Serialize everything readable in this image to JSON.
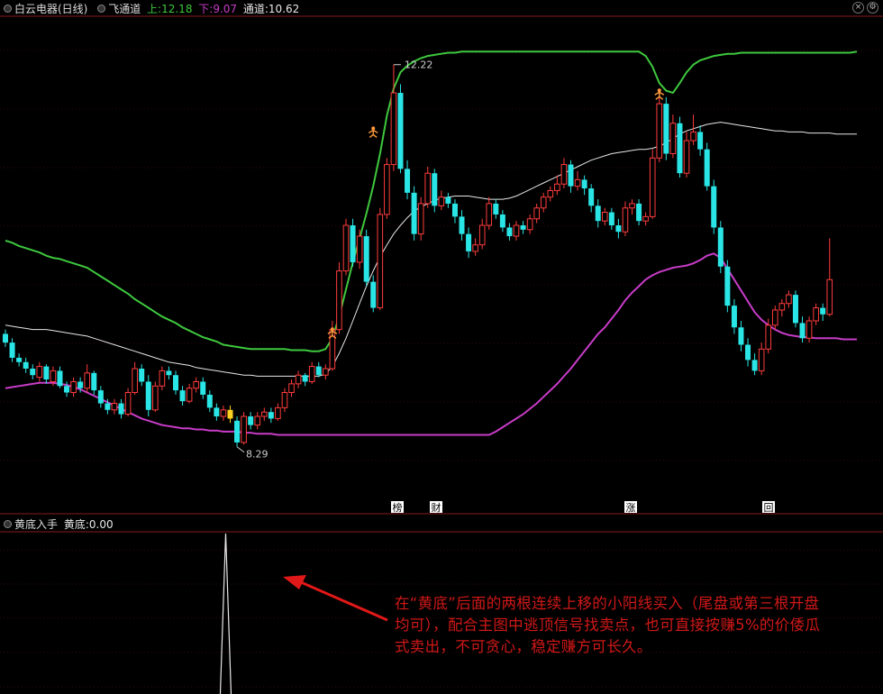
{
  "header": {
    "stock": "白云电器(日线)",
    "indicator": "飞通道",
    "upper_label": "上:",
    "upper_value": "12.18",
    "lower_label": "下:",
    "lower_value": "9.07",
    "mid_label": "通道:",
    "mid_value": "10.62"
  },
  "sub_header": {
    "indicator": "黄底入手",
    "value_label": "黄底:",
    "value": "0.00"
  },
  "markers": [
    "榜",
    "财",
    "涨",
    "回"
  ],
  "annotation": "在“黄底”后面的两根连续上移的小阳线买入（尾盘或第三根开盘均可），配合主图中逃顶信号找卖点，也可直接按赚5%的价倭瓜式卖出，不可贪心，稳定赚方可长久。",
  "colors": {
    "up": "#ff3c3c",
    "down": "#2ae5e5",
    "upper_band": "#3ec83e",
    "lower_band": "#c83cc8",
    "mid_line": "#e8e8e8",
    "signal_bar": "#ffd020",
    "arrow": "#e01818"
  },
  "chart_data": {
    "type": "candlestick",
    "price_high_label": "12.22",
    "price_low_label": "8.29",
    "ylim": [
      8.1,
      12.5
    ],
    "candles": [
      [
        9.74,
        9.66,
        9.78,
        9.62
      ],
      [
        9.66,
        9.52,
        9.7,
        9.48
      ],
      [
        9.52,
        9.48,
        9.56,
        9.44
      ],
      [
        9.48,
        9.42,
        9.52,
        9.38
      ],
      [
        9.42,
        9.36,
        9.46,
        9.32
      ],
      [
        9.34,
        9.44,
        9.48,
        9.3
      ],
      [
        9.44,
        9.32,
        9.46,
        9.28
      ],
      [
        9.3,
        9.4,
        9.44,
        9.26
      ],
      [
        9.4,
        9.26,
        9.44,
        9.24
      ],
      [
        9.26,
        9.2,
        9.3,
        9.16
      ],
      [
        9.2,
        9.3,
        9.34,
        9.16
      ],
      [
        9.3,
        9.24,
        9.34,
        9.2
      ],
      [
        9.24,
        9.38,
        9.46,
        9.2
      ],
      [
        9.38,
        9.22,
        9.4,
        9.18
      ],
      [
        9.22,
        9.1,
        9.26,
        9.06
      ],
      [
        9.1,
        9.04,
        9.14,
        9.0
      ],
      [
        9.04,
        9.1,
        9.14,
        9.0
      ],
      [
        9.1,
        9.0,
        9.14,
        8.96
      ],
      [
        9.0,
        9.2,
        9.24,
        8.98
      ],
      [
        9.2,
        9.42,
        9.48,
        9.18
      ],
      [
        9.42,
        9.3,
        9.46,
        9.26
      ],
      [
        9.3,
        9.04,
        9.36,
        8.98
      ],
      [
        9.04,
        9.26,
        9.3,
        9.02
      ],
      [
        9.26,
        9.4,
        9.44,
        9.22
      ],
      [
        9.4,
        9.36,
        9.44,
        9.32
      ],
      [
        9.36,
        9.22,
        9.4,
        9.18
      ],
      [
        9.22,
        9.12,
        9.26,
        9.08
      ],
      [
        9.12,
        9.24,
        9.28,
        9.1
      ],
      [
        9.24,
        9.3,
        9.34,
        9.2
      ],
      [
        9.3,
        9.18,
        9.34,
        9.14
      ],
      [
        9.18,
        9.06,
        9.22,
        9.02
      ],
      [
        9.06,
        8.98,
        9.1,
        8.94
      ],
      [
        8.98,
        9.04,
        9.08,
        8.94
      ],
      [
        9.04,
        8.96,
        9.08,
        8.92
      ],
      [
        8.94,
        8.74,
        8.98,
        8.7
      ],
      [
        8.74,
        8.98,
        9.02,
        8.72
      ],
      [
        8.98,
        8.9,
        9.02,
        8.86
      ],
      [
        8.9,
        8.98,
        9.02,
        8.86
      ],
      [
        8.98,
        9.02,
        9.06,
        8.94
      ],
      [
        9.02,
        8.96,
        9.06,
        8.92
      ],
      [
        8.96,
        9.06,
        9.1,
        8.94
      ],
      [
        9.06,
        9.2,
        9.24,
        9.02
      ],
      [
        9.2,
        9.28,
        9.32,
        9.16
      ],
      [
        9.28,
        9.36,
        9.4,
        9.24
      ],
      [
        9.36,
        9.3,
        9.38,
        9.26
      ],
      [
        9.3,
        9.44,
        9.48,
        9.28
      ],
      [
        9.44,
        9.36,
        9.48,
        9.34
      ],
      [
        9.36,
        9.42,
        9.46,
        9.32
      ],
      [
        9.42,
        9.78,
        9.86,
        9.4
      ],
      [
        9.78,
        10.32,
        10.4,
        9.74
      ],
      [
        10.32,
        10.74,
        10.8,
        10.28
      ],
      [
        10.74,
        10.4,
        10.8,
        10.36
      ],
      [
        10.4,
        10.64,
        10.7,
        10.34
      ],
      [
        10.64,
        10.22,
        10.7,
        10.18
      ],
      [
        10.22,
        9.98,
        10.28,
        9.94
      ],
      [
        9.98,
        10.84,
        10.9,
        9.96
      ],
      [
        10.84,
        11.3,
        11.36,
        10.8
      ],
      [
        11.3,
        11.96,
        12.22,
        11.24
      ],
      [
        11.96,
        11.26,
        12.04,
        11.22
      ],
      [
        11.26,
        11.04,
        11.34,
        10.98
      ],
      [
        11.04,
        10.66,
        11.1,
        10.6
      ],
      [
        10.66,
        10.94,
        11.0,
        10.6
      ],
      [
        10.94,
        11.22,
        11.28,
        10.9
      ],
      [
        11.22,
        10.92,
        11.26,
        10.86
      ],
      [
        10.92,
        11.0,
        11.06,
        10.88
      ],
      [
        11.0,
        10.94,
        11.04,
        10.9
      ],
      [
        10.94,
        10.82,
        10.98,
        10.76
      ],
      [
        10.82,
        10.66,
        10.88,
        10.6
      ],
      [
        10.66,
        10.5,
        10.72,
        10.44
      ],
      [
        10.5,
        10.56,
        10.62,
        10.46
      ],
      [
        10.56,
        10.74,
        10.8,
        10.52
      ],
      [
        10.74,
        10.94,
        11.0,
        10.7
      ],
      [
        10.94,
        10.84,
        10.98,
        10.8
      ],
      [
        10.84,
        10.72,
        10.88,
        10.68
      ],
      [
        10.72,
        10.64,
        10.76,
        10.6
      ],
      [
        10.64,
        10.74,
        10.78,
        10.6
      ],
      [
        10.74,
        10.7,
        10.78,
        10.66
      ],
      [
        10.7,
        10.8,
        10.84,
        10.66
      ],
      [
        10.8,
        10.9,
        10.94,
        10.76
      ],
      [
        10.9,
        11.0,
        11.04,
        10.86
      ],
      [
        11.0,
        11.06,
        11.1,
        10.96
      ],
      [
        11.06,
        11.12,
        11.2,
        11.02
      ],
      [
        11.12,
        11.3,
        11.36,
        11.08
      ],
      [
        11.3,
        11.1,
        11.34,
        11.04
      ],
      [
        11.1,
        11.16,
        11.24,
        11.06
      ],
      [
        11.16,
        11.08,
        11.2,
        11.02
      ],
      [
        11.08,
        10.92,
        11.12,
        10.86
      ],
      [
        10.92,
        10.78,
        10.98,
        10.72
      ],
      [
        10.78,
        10.86,
        10.9,
        10.74
      ],
      [
        10.86,
        10.74,
        10.9,
        10.7
      ],
      [
        10.74,
        10.68,
        10.8,
        10.62
      ],
      [
        10.68,
        10.9,
        10.96,
        10.64
      ],
      [
        10.9,
        10.94,
        10.98,
        10.84
      ],
      [
        10.94,
        10.78,
        10.98,
        10.74
      ],
      [
        10.78,
        10.82,
        10.86,
        10.74
      ],
      [
        10.82,
        11.36,
        11.44,
        10.8
      ],
      [
        11.36,
        11.86,
        11.94,
        11.32
      ],
      [
        11.86,
        11.4,
        11.92,
        11.34
      ],
      [
        11.4,
        11.68,
        11.76,
        11.36
      ],
      [
        11.68,
        11.22,
        11.74,
        11.18
      ],
      [
        11.22,
        11.52,
        11.6,
        11.18
      ],
      [
        11.52,
        11.6,
        11.76,
        11.48
      ],
      [
        11.6,
        11.44,
        11.66,
        11.38
      ],
      [
        11.44,
        11.1,
        11.5,
        11.06
      ],
      [
        11.1,
        10.72,
        11.16,
        10.66
      ],
      [
        10.72,
        10.36,
        10.78,
        10.3
      ],
      [
        10.36,
        10.0,
        10.42,
        9.94
      ],
      [
        10.0,
        9.8,
        10.06,
        9.74
      ],
      [
        9.8,
        9.64,
        9.86,
        9.58
      ],
      [
        9.64,
        9.5,
        9.7,
        9.44
      ],
      [
        9.5,
        9.4,
        9.56,
        9.36
      ],
      [
        9.4,
        9.6,
        9.66,
        9.36
      ],
      [
        9.6,
        9.82,
        9.88,
        9.56
      ],
      [
        9.82,
        9.96,
        10.0,
        9.78
      ],
      [
        9.96,
        10.02,
        10.06,
        9.9
      ],
      [
        10.02,
        10.1,
        10.14,
        9.98
      ],
      [
        10.1,
        9.84,
        10.14,
        9.8
      ],
      [
        9.84,
        9.7,
        9.9,
        9.66
      ],
      [
        9.7,
        9.86,
        9.9,
        9.66
      ],
      [
        9.86,
        9.98,
        10.02,
        9.82
      ],
      [
        9.98,
        9.92,
        10.02,
        9.86
      ],
      [
        9.92,
        10.24,
        10.62,
        9.9
      ]
    ],
    "upper_band": [
      10.6,
      10.58,
      10.55,
      10.53,
      10.51,
      10.49,
      10.46,
      10.44,
      10.43,
      10.41,
      10.39,
      10.37,
      10.35,
      10.31,
      10.27,
      10.23,
      10.19,
      10.15,
      10.11,
      10.06,
      10.02,
      9.98,
      9.94,
      9.9,
      9.87,
      9.84,
      9.8,
      9.77,
      9.74,
      9.71,
      9.69,
      9.67,
      9.64,
      9.63,
      9.62,
      9.61,
      9.6,
      9.6,
      9.6,
      9.6,
      9.6,
      9.6,
      9.59,
      9.59,
      9.59,
      9.58,
      9.58,
      9.6,
      9.7,
      9.9,
      10.15,
      10.4,
      10.62,
      10.85,
      11.1,
      11.4,
      11.75,
      12.0,
      12.15,
      12.21,
      12.25,
      12.28,
      12.3,
      12.31,
      12.32,
      12.33,
      12.33,
      12.34,
      12.34,
      12.34,
      12.34,
      12.34,
      12.34,
      12.34,
      12.34,
      12.34,
      12.34,
      12.34,
      12.34,
      12.34,
      12.34,
      12.34,
      12.34,
      12.34,
      12.34,
      12.34,
      12.34,
      12.34,
      12.34,
      12.34,
      12.34,
      12.34,
      12.34,
      12.34,
      12.3,
      12.2,
      12.05,
      11.98,
      11.96,
      12.05,
      12.15,
      12.22,
      12.26,
      12.28,
      12.3,
      12.31,
      12.32,
      12.32,
      12.33,
      12.33,
      12.33,
      12.33,
      12.33,
      12.33,
      12.33,
      12.33,
      12.33,
      12.33,
      12.33,
      12.33,
      12.33,
      12.33,
      12.33,
      12.33,
      12.33,
      12.34
    ],
    "lower_band": [
      9.24,
      9.25,
      9.26,
      9.27,
      9.28,
      9.29,
      9.29,
      9.29,
      9.28,
      9.27,
      9.25,
      9.23,
      9.2,
      9.17,
      9.14,
      9.11,
      9.08,
      9.05,
      9.02,
      8.99,
      8.96,
      8.94,
      8.92,
      8.9,
      8.89,
      8.88,
      8.87,
      8.87,
      8.86,
      8.86,
      8.85,
      8.85,
      8.84,
      8.84,
      8.84,
      8.83,
      8.83,
      8.82,
      8.82,
      8.82,
      8.81,
      8.81,
      8.81,
      8.81,
      8.81,
      8.81,
      8.81,
      8.81,
      8.81,
      8.81,
      8.81,
      8.81,
      8.81,
      8.81,
      8.81,
      8.81,
      8.81,
      8.81,
      8.81,
      8.81,
      8.81,
      8.81,
      8.81,
      8.81,
      8.81,
      8.81,
      8.81,
      8.81,
      8.81,
      8.81,
      8.81,
      8.81,
      8.84,
      8.88,
      8.92,
      8.96,
      9.0,
      9.05,
      9.1,
      9.16,
      9.22,
      9.28,
      9.35,
      9.42,
      9.5,
      9.58,
      9.66,
      9.74,
      9.8,
      9.88,
      9.96,
      10.05,
      10.12,
      10.18,
      10.24,
      10.28,
      10.31,
      10.33,
      10.35,
      10.36,
      10.37,
      10.39,
      10.42,
      10.46,
      10.48,
      10.44,
      10.34,
      10.24,
      10.14,
      10.04,
      9.94,
      9.87,
      9.82,
      9.78,
      9.75,
      9.73,
      9.72,
      9.71,
      9.71,
      9.7,
      9.7,
      9.7,
      9.7,
      9.69,
      9.69,
      9.69
    ],
    "mid_line": [
      9.82,
      9.81,
      9.8,
      9.79,
      9.78,
      9.78,
      9.78,
      9.77,
      9.76,
      9.75,
      9.74,
      9.73,
      9.72,
      9.7,
      9.68,
      9.66,
      9.64,
      9.62,
      9.6,
      9.58,
      9.56,
      9.54,
      9.52,
      9.5,
      9.48,
      9.47,
      9.46,
      9.45,
      9.43,
      9.42,
      9.41,
      9.4,
      9.39,
      9.38,
      9.37,
      9.36,
      9.36,
      9.35,
      9.35,
      9.35,
      9.35,
      9.35,
      9.35,
      9.35,
      9.35,
      9.35,
      9.35,
      9.37,
      9.44,
      9.56,
      9.7,
      9.86,
      10.02,
      10.18,
      10.32,
      10.45,
      10.56,
      10.66,
      10.74,
      10.81,
      10.87,
      10.91,
      10.94,
      10.97,
      10.99,
      11.0,
      11.01,
      11.01,
      11.01,
      11.0,
      10.99,
      10.98,
      10.98,
      10.98,
      10.99,
      11.01,
      11.04,
      11.07,
      11.1,
      11.13,
      11.16,
      11.19,
      11.22,
      11.25,
      11.28,
      11.31,
      11.34,
      11.36,
      11.38,
      11.4,
      11.41,
      11.42,
      11.43,
      11.44,
      11.44,
      11.45,
      11.47,
      11.5,
      11.54,
      11.58,
      11.61,
      11.63,
      11.65,
      11.67,
      11.68,
      11.69,
      11.68,
      11.67,
      11.66,
      11.65,
      11.64,
      11.63,
      11.62,
      11.61,
      11.61,
      11.6,
      11.6,
      11.6,
      11.59,
      11.59,
      11.59,
      11.59,
      11.58,
      11.58,
      11.58,
      11.58
    ],
    "buy_signal_index": 33,
    "sub_signal_value": 1.0,
    "sub_ylim": [
      0,
      1
    ]
  }
}
